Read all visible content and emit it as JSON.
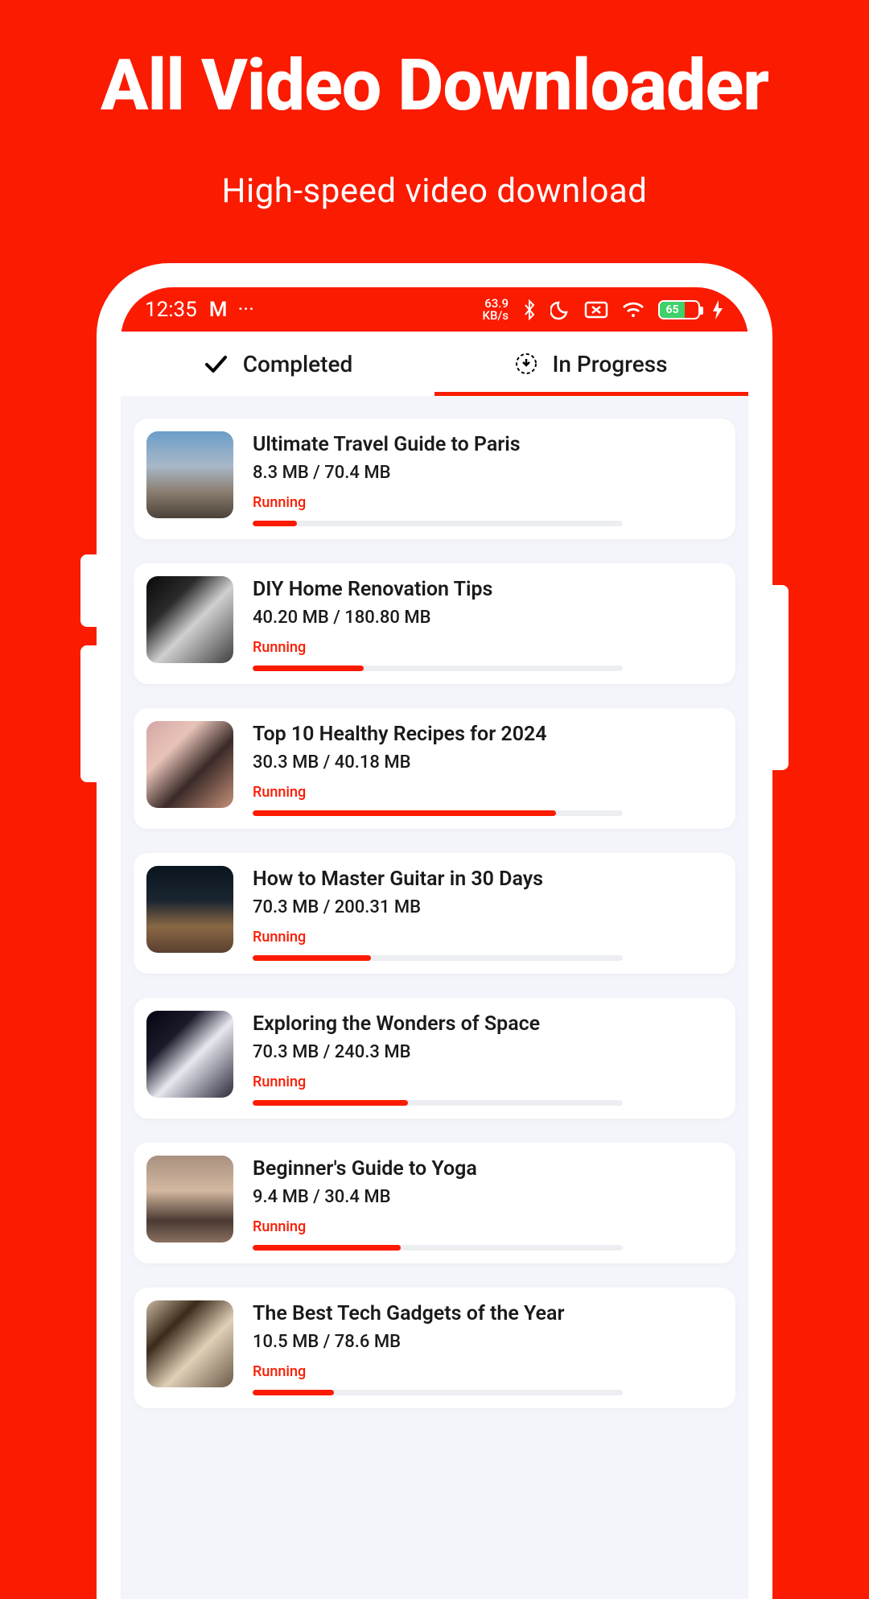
{
  "header": {
    "title": "All Video Downloader",
    "subtitle": "High-speed video download"
  },
  "statusbar": {
    "time": "12:35",
    "mail_icon": "M",
    "dots": "···",
    "speed_top": "63.9",
    "speed_bottom": "KB/s",
    "battery": "65"
  },
  "tabs": {
    "completed": "Completed",
    "in_progress": "In Progress"
  },
  "items": [
    {
      "title": "Ultimate Travel Guide to Paris",
      "size": "8.3 MB / 70.4 MB",
      "status": "Running",
      "progress": 12,
      "thumb": "t1"
    },
    {
      "title": "DIY Home Renovation Tips",
      "size": "40.20 MB / 180.80 MB",
      "status": "Running",
      "progress": 30,
      "thumb": "t2"
    },
    {
      "title": "Top 10 Healthy Recipes for 2024",
      "size": "30.3 MB / 40.18 MB",
      "status": "Running",
      "progress": 82,
      "thumb": "t3"
    },
    {
      "title": "How to Master Guitar in 30 Days",
      "size": "70.3 MB / 200.31 MB",
      "status": "Running",
      "progress": 32,
      "thumb": "t4"
    },
    {
      "title": "Exploring the Wonders of Space",
      "size": "70.3 MB / 240.3 MB",
      "status": "Running",
      "progress": 42,
      "thumb": "t5"
    },
    {
      "title": "Beginner's Guide to Yoga",
      "size": "9.4 MB / 30.4 MB",
      "status": "Running",
      "progress": 40,
      "thumb": "t6"
    },
    {
      "title": "The Best Tech Gadgets of the Year",
      "size": "10.5 MB / 78.6 MB",
      "status": "Running",
      "progress": 22,
      "thumb": "t7"
    }
  ]
}
